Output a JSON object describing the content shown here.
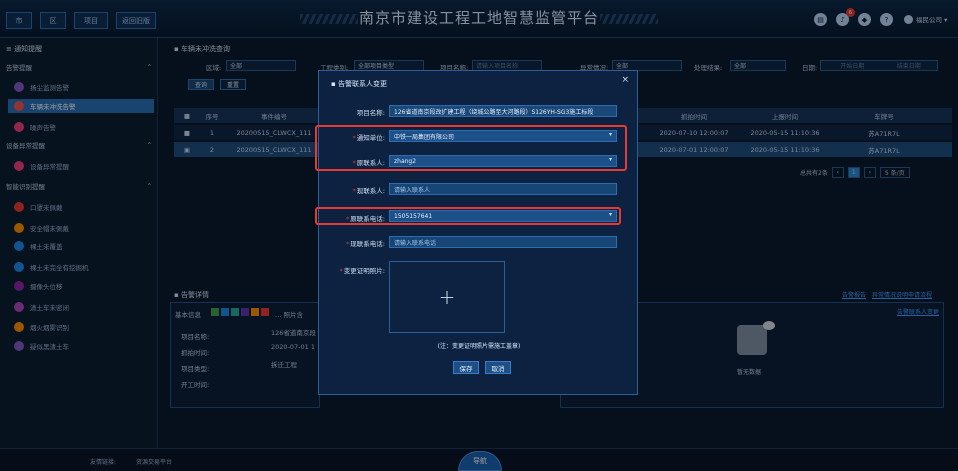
{
  "header": {
    "title": "南京市建设工程工地智慧监管平台",
    "btn_city": "市",
    "btn_district": "区",
    "btn_project": "项目",
    "btn_back": "返回旧版",
    "notif_count": "6",
    "user_name": "福民公司"
  },
  "sidebar": {
    "heading": "通知提醒",
    "groups": [
      {
        "label": "告警提醒",
        "items": [
          {
            "label": "扬尘监测告警",
            "color": "#7e57c2"
          },
          {
            "label": "车辆未冲洗告警",
            "color": "#ef5350",
            "active": true
          },
          {
            "label": "噪声告警",
            "color": "#ec407a"
          }
        ]
      },
      {
        "label": "设备异常提醒",
        "items": [
          {
            "label": "设备异常提醒",
            "color": "#ec407a"
          }
        ]
      },
      {
        "label": "智能识别提醒",
        "items": [
          {
            "label": "口罩未佩戴",
            "color": "#e53935"
          },
          {
            "label": "安全帽未佩戴",
            "color": "#fb8c00"
          },
          {
            "label": "裸土未覆盖",
            "color": "#1e88e5"
          },
          {
            "label": "裸土未完全有挖掘机",
            "color": "#1e88e5"
          },
          {
            "label": "摄像头位移",
            "color": "#8e24aa"
          },
          {
            "label": "渣土车未密闭",
            "color": "#ab47bc"
          },
          {
            "label": "烟火烟雾识别",
            "color": "#fb8c00"
          },
          {
            "label": "疑似黑渣土车",
            "color": "#7e57c2"
          }
        ]
      }
    ]
  },
  "main": {
    "section_title": "车辆未冲洗查询",
    "filters": {
      "area_label": "区域:",
      "area_value": "全部",
      "type_label": "工程类别:",
      "type_value": "全部项目类型",
      "name_label": "项目名称:",
      "name_placeholder": "请输入项目名称",
      "abnormal_label": "异常情况:",
      "abnormal_value": "全部",
      "result_label": "处理结果:",
      "result_value": "全部",
      "date_label": "日期:",
      "date_start": "开始日期",
      "date_end": "结束日期",
      "query": "查询",
      "reset": "重置"
    },
    "table": {
      "headers": {
        "seq": "序号",
        "code": "事件编号",
        "capture": "抓拍时间",
        "report": "上报时间",
        "plate": "车牌号"
      },
      "rows": [
        {
          "seq": "1",
          "code": "20200515_CLWCX_111",
          "capture": "2020-07-10 12:00:07",
          "report": "2020-05-15 11:10:36",
          "plate": "苏A71R7L"
        },
        {
          "seq": "2",
          "code": "20200515_CLWCX_111",
          "capture": "2020-07-01 12:00:07",
          "report": "2020-05-15 11:10:36",
          "plate": "苏A71R7L"
        }
      ],
      "total": "总共有2条",
      "page": "1",
      "page_size": "5 条/页"
    },
    "detail": {
      "title": "告警详情",
      "basic_info": "基本信息",
      "photo_label": "照片含",
      "rows": [
        {
          "label": "项目名称:",
          "value": "126省道南京段"
        },
        {
          "label": "抓拍时间:",
          "value": "2020-07-01 1"
        },
        {
          "label": "项目类型:",
          "value": "拆迁工程"
        },
        {
          "label": "开工时间:",
          "value": ""
        }
      ],
      "link_report": "告警报告",
      "link_abnormal": "异常情况说明申请流程",
      "link_contact": "告警联系人变更",
      "empty": "暂无数据"
    }
  },
  "modal": {
    "title": "告警联系人变更",
    "project_label": "项目名称:",
    "project_value": "126省道南京段改扩建工程（绕城公路至大河路段）S126YH-SG3施工标段",
    "notify_label": "通知单位:",
    "notify_value": "中铁一局集团有限公司",
    "orig_contact_label": "原联系人:",
    "orig_contact_value": "zhang2",
    "new_contact_label": "现联系人:",
    "new_contact_placeholder": "请输入联系人",
    "orig_phone_label": "原联系电话:",
    "orig_phone_value": "1505157641",
    "new_phone_label": "现联系电话:",
    "new_phone_placeholder": "请输入联系电话",
    "photo_label": "变更证明照片:",
    "upload_symbol": "+",
    "note": "(注：变更证明照片需施工盖章)",
    "save": "保存",
    "cancel": "取消",
    "close": "×"
  },
  "footer": {
    "links_label": "友情链接:",
    "link_1": "资源交易平台",
    "nav": "导航"
  }
}
